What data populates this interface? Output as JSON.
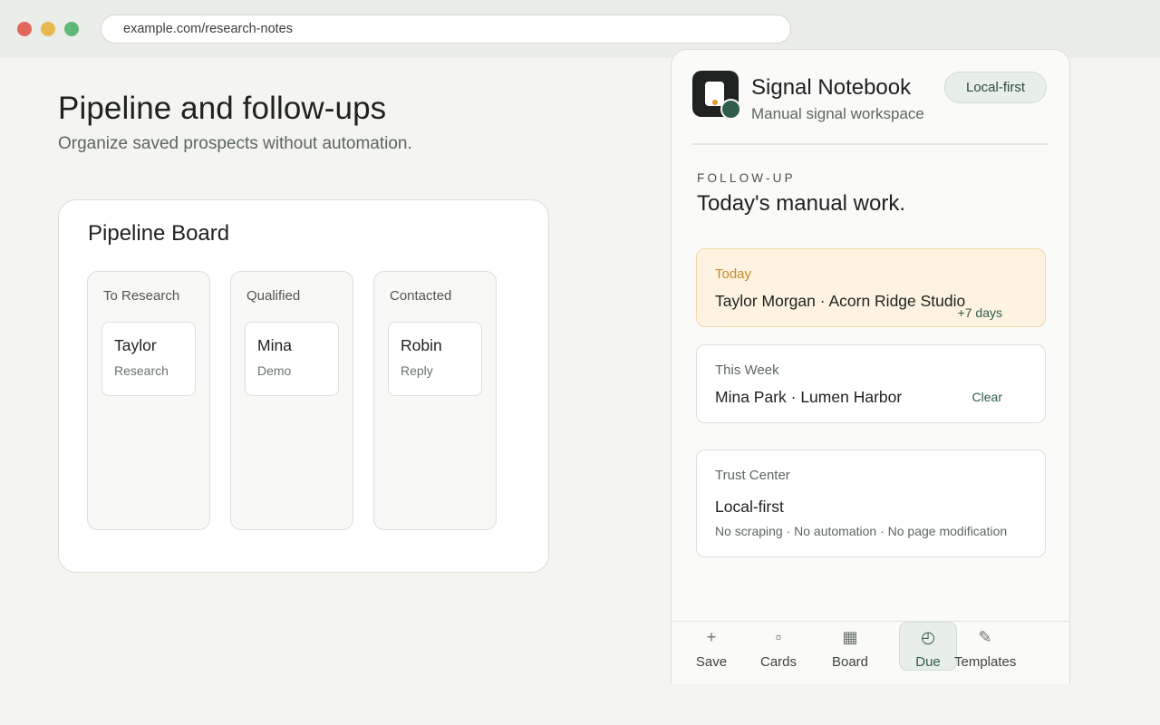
{
  "browser": {
    "url": "example.com/research-notes"
  },
  "page": {
    "title": "Pipeline and follow-ups",
    "subtitle": "Organize saved prospects without automation."
  },
  "board": {
    "title": "Pipeline Board",
    "columns": [
      {
        "title": "To Research",
        "card": {
          "name": "Taylor",
          "stage": "Research"
        }
      },
      {
        "title": "Qualified",
        "card": {
          "name": "Mina",
          "stage": "Demo"
        }
      },
      {
        "title": "Contacted",
        "card": {
          "name": "Robin",
          "stage": "Reply"
        }
      }
    ]
  },
  "panel": {
    "app_name": "Signal Notebook",
    "app_subtitle": "Manual signal workspace",
    "mode_pill": "Local-first",
    "eyebrow": "FOLLOW-UP",
    "section_title": "Today's manual work.",
    "items": [
      {
        "label": "Today",
        "main": "Taylor Morgan · Acorn Ridge Studio",
        "tag": "+7 days"
      },
      {
        "label": "This Week",
        "main": "Mina Park · Lumen Harbor",
        "tag": "Clear"
      },
      {
        "label": "Trust Center",
        "main": "Local-first",
        "note": "No scraping · No automation · No page modification"
      }
    ],
    "nav": [
      {
        "icon": "+",
        "icon_name": "plus-icon",
        "label": "Save"
      },
      {
        "icon": "▫",
        "icon_name": "card-icon",
        "label": "Cards"
      },
      {
        "icon": "▦",
        "icon_name": "board-icon",
        "label": "Board"
      },
      {
        "icon": "◴",
        "icon_name": "clock-icon",
        "label": "Due",
        "active": true
      },
      {
        "icon": "✎",
        "icon_name": "pencil-icon",
        "label": "Templates"
      }
    ]
  },
  "colors": {
    "accent": "#2f5c4b",
    "today_bg": "#fdf3e0",
    "today_label": "#c48a2a",
    "logo_dot": "#e09a2c"
  }
}
